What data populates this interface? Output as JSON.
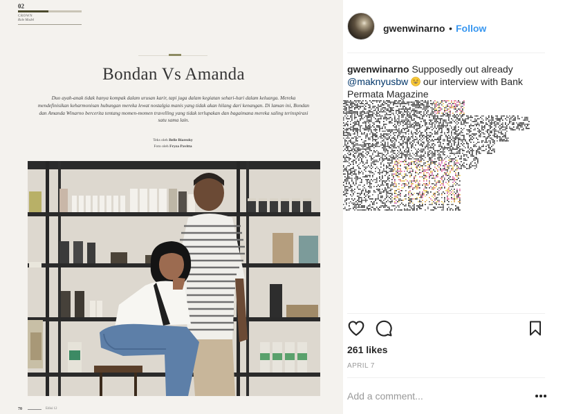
{
  "magazine": {
    "page_number": "02",
    "section": "CROWN",
    "subsection": "Role Model",
    "title": "Bondan Vs Amanda",
    "lede": "Duo ayah-anak tidak hanya kompak dalam urusan karir, tapi juga dalam kegiatan sehari-hari dalam keluarga. Mereka mendefinisikan keharmonisan hubungan mereka lewat nostalgia manis yang tidak akan hilang dari kenangan. Di laman ini, Bondan dan Amanda Winarno bercerita tentang momen-momen travelling yang tidak terlupakan dan bagaimana mereka saling terinspirasi satu sama lain.",
    "credit_text_label": "Teks oleh",
    "credit_text_name": "Belle Biarezky",
    "credit_photo_label": "Foto oleh",
    "credit_photo_name": "Fryza Pavitta",
    "footer_page": "70",
    "footer_edition": "Edisi 12"
  },
  "post": {
    "username": "gwenwinarno",
    "separator": "•",
    "follow_label": "Follow",
    "caption_user": "gwenwinarno",
    "caption_text_1": " Supposedly out already ",
    "caption_mention": "@maknyusbw",
    "caption_text_2": " our interview with Bank Permata Magazine",
    "likes": "261 likes",
    "date": "APRIL 7",
    "comment_placeholder": "Add a comment...",
    "icons": {
      "like": "heart-icon",
      "comment": "speech-bubble-icon",
      "save": "bookmark-icon",
      "more": "more-options-icon",
      "emoji": "grinning-face-emoji"
    }
  },
  "colors": {
    "link_blue": "#3897f0",
    "mention_blue": "#003569",
    "text": "#262626",
    "muted": "#999999",
    "magazine_bg": "#f4f2ee"
  }
}
